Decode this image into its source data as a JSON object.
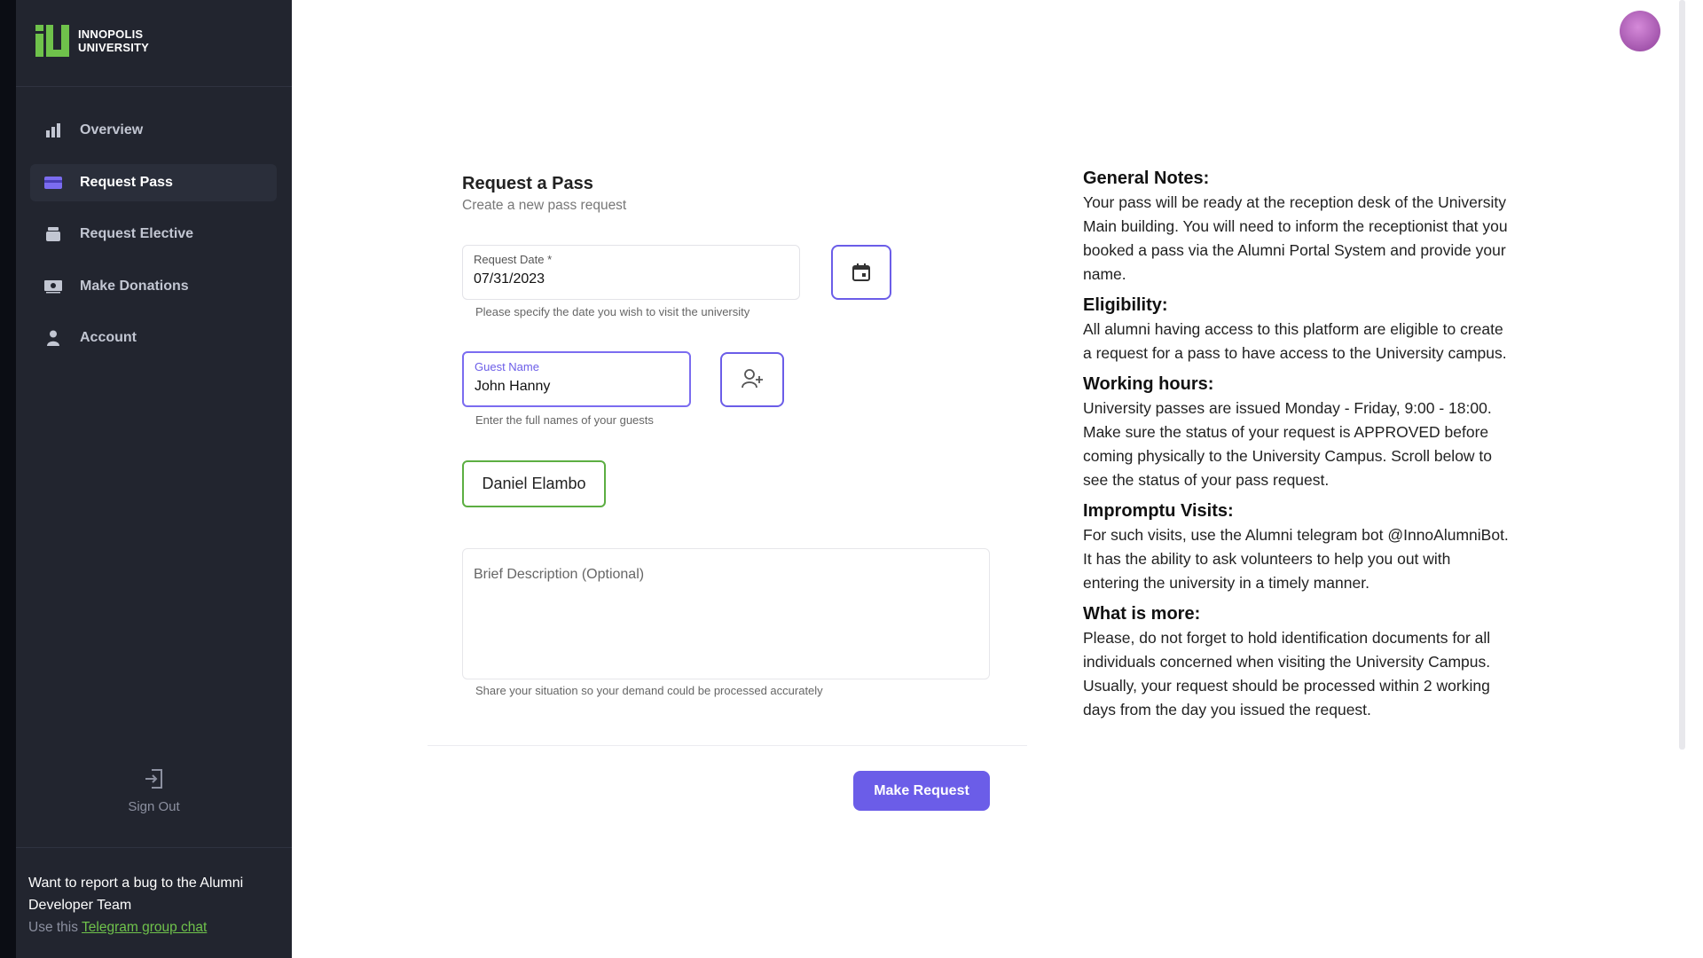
{
  "brand": {
    "line1": "INNOPOLIS",
    "line2": "UNIVERSITY",
    "logo_color": "#6fc24b"
  },
  "sidebar": {
    "items": [
      {
        "label": "Overview",
        "icon": "bar-chart-icon",
        "active": false
      },
      {
        "label": "Request Pass",
        "icon": "card-icon",
        "active": true
      },
      {
        "label": "Request Elective",
        "icon": "stack-icon",
        "active": false
      },
      {
        "label": "Make Donations",
        "icon": "money-icon",
        "active": false
      },
      {
        "label": "Account",
        "icon": "user-icon",
        "active": false
      }
    ],
    "sign_out": "Sign Out",
    "bug_report": {
      "text": "Want to report a bug to the Alumni Developer Team",
      "use_prefix": "Use this",
      "link_text": "Telegram group chat"
    }
  },
  "form": {
    "title": "Request a Pass",
    "subtitle": "Create a new pass request",
    "date": {
      "label": "Request Date *",
      "value": "07/31/2023",
      "helper": "Please specify the date you wish to visit the university"
    },
    "guest": {
      "label": "Guest Name",
      "value": "John Hanny",
      "helper": "Enter the full names of your guests"
    },
    "guests_added": [
      "Daniel Elambo"
    ],
    "description": {
      "placeholder": "Brief Description (Optional)",
      "helper": "Share your situation so your demand could be processed accurately"
    },
    "submit_label": "Make Request"
  },
  "notes": [
    {
      "title": "General Notes:",
      "body": "Your pass will be ready at the reception desk of the University Main building. You will need to inform the receptionist that you booked a pass via the Alumni Portal System and provide your name."
    },
    {
      "title": "Eligibility:",
      "body": "All alumni having access to this platform are eligible to create a request for a pass to have access to the University campus."
    },
    {
      "title": "Working hours:",
      "body": "University passes are issued Monday - Friday, 9:00 - 18:00. Make sure the status of your request is APPROVED before coming physically to the University Campus. Scroll below to see the status of your pass request."
    },
    {
      "title": "Impromptu Visits:",
      "body": "For such visits, use the Alumni telegram bot @InnoAlumniBot. It has the ability to ask volunteers to help you out with entering the university in a timely manner."
    },
    {
      "title": "What is more:",
      "body": "Please, do not forget to hold identification documents for all individuals concerned when visiting the University Campus. Usually, your request should be processed within 2 working days from the day you issued the request."
    }
  ],
  "colors": {
    "accent": "#6b5de8",
    "success": "#5cae42",
    "sidebar_bg": "#22252f"
  }
}
